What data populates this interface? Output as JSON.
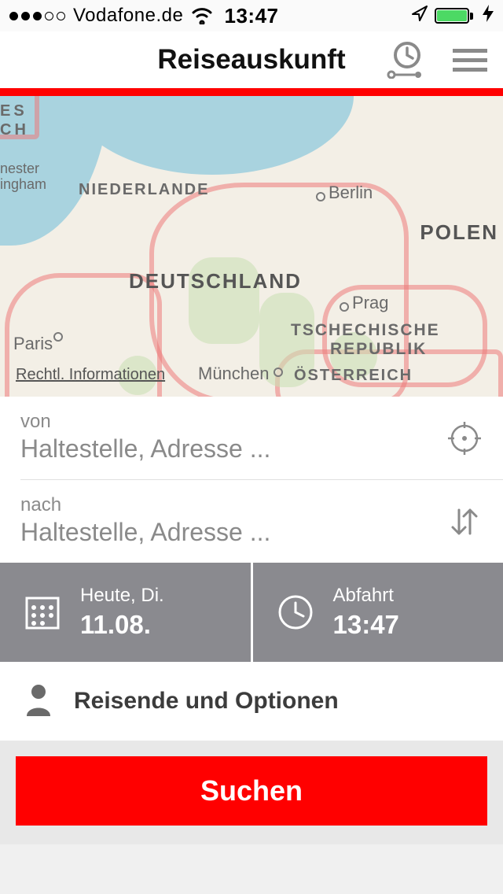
{
  "status": {
    "carrier": "Vodafone.de",
    "time": "13:47"
  },
  "header": {
    "title": "Reiseauskunft"
  },
  "map": {
    "legal": "Rechtl. Informationen",
    "labels": {
      "ch_frag1": "ES",
      "ch_frag2": "CH",
      "nester_frag": "nester",
      "ingham_frag": "ingham",
      "niederlande": "NIEDERLANDE",
      "berlin": "Berlin",
      "polen": "POLEN",
      "deutschland": "DEUTSCHLAND",
      "prag": "Prag",
      "tschechische1": "TSCHECHISCHE",
      "tschechische2": "REPUBLIK",
      "paris": "Paris",
      "muenchen": "München",
      "oesterreich": "ÖSTERREICH"
    }
  },
  "form": {
    "from_label": "von",
    "from_placeholder": "Haltestelle, Adresse ...",
    "to_label": "nach",
    "to_placeholder": "Haltestelle, Adresse ..."
  },
  "datetime": {
    "date_top": "Heute, Di.",
    "date_bottom": "11.08.",
    "time_top": "Abfahrt",
    "time_bottom": "13:47"
  },
  "options": {
    "label": "Reisende und Optionen"
  },
  "search": {
    "label": "Suchen"
  }
}
